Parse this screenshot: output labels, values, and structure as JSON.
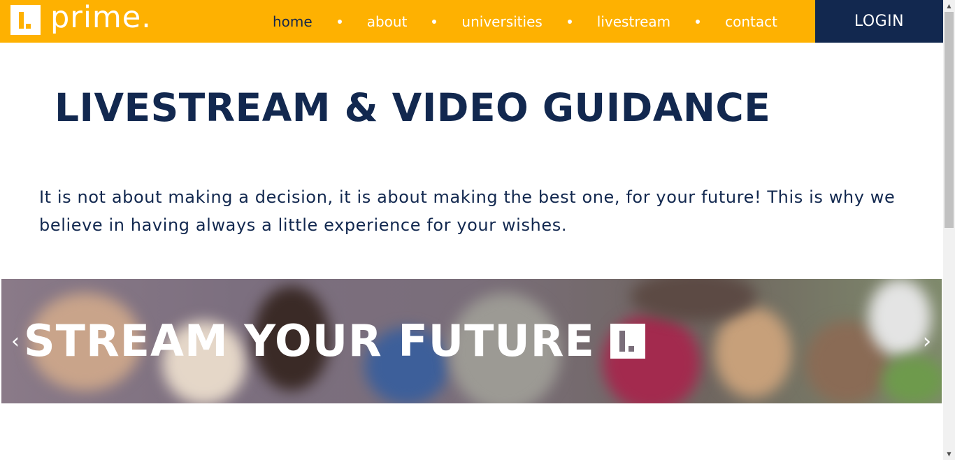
{
  "header": {
    "logo_text": "prime.",
    "nav": [
      {
        "label": "home",
        "active": true
      },
      {
        "label": "about",
        "active": false
      },
      {
        "label": "universities",
        "active": false
      },
      {
        "label": "livestream",
        "active": false
      },
      {
        "label": "contact",
        "active": false
      }
    ],
    "login_label": "LOGIN"
  },
  "main": {
    "title": "LIVESTREAM & VIDEO GUIDANCE",
    "intro": "It is not about making a decision, it is about making the best one, for your future! This is why we believe in having always a little experience for your wishes."
  },
  "banner": {
    "headline": "STREAM YOUR FUTURE",
    "prev_icon": "‹",
    "next_icon": "›"
  },
  "colors": {
    "brand_yellow": "#feb101",
    "brand_navy": "#12284f"
  },
  "icons": [
    "logo-mark-icon",
    "chevron-left-icon",
    "chevron-right-icon"
  ]
}
